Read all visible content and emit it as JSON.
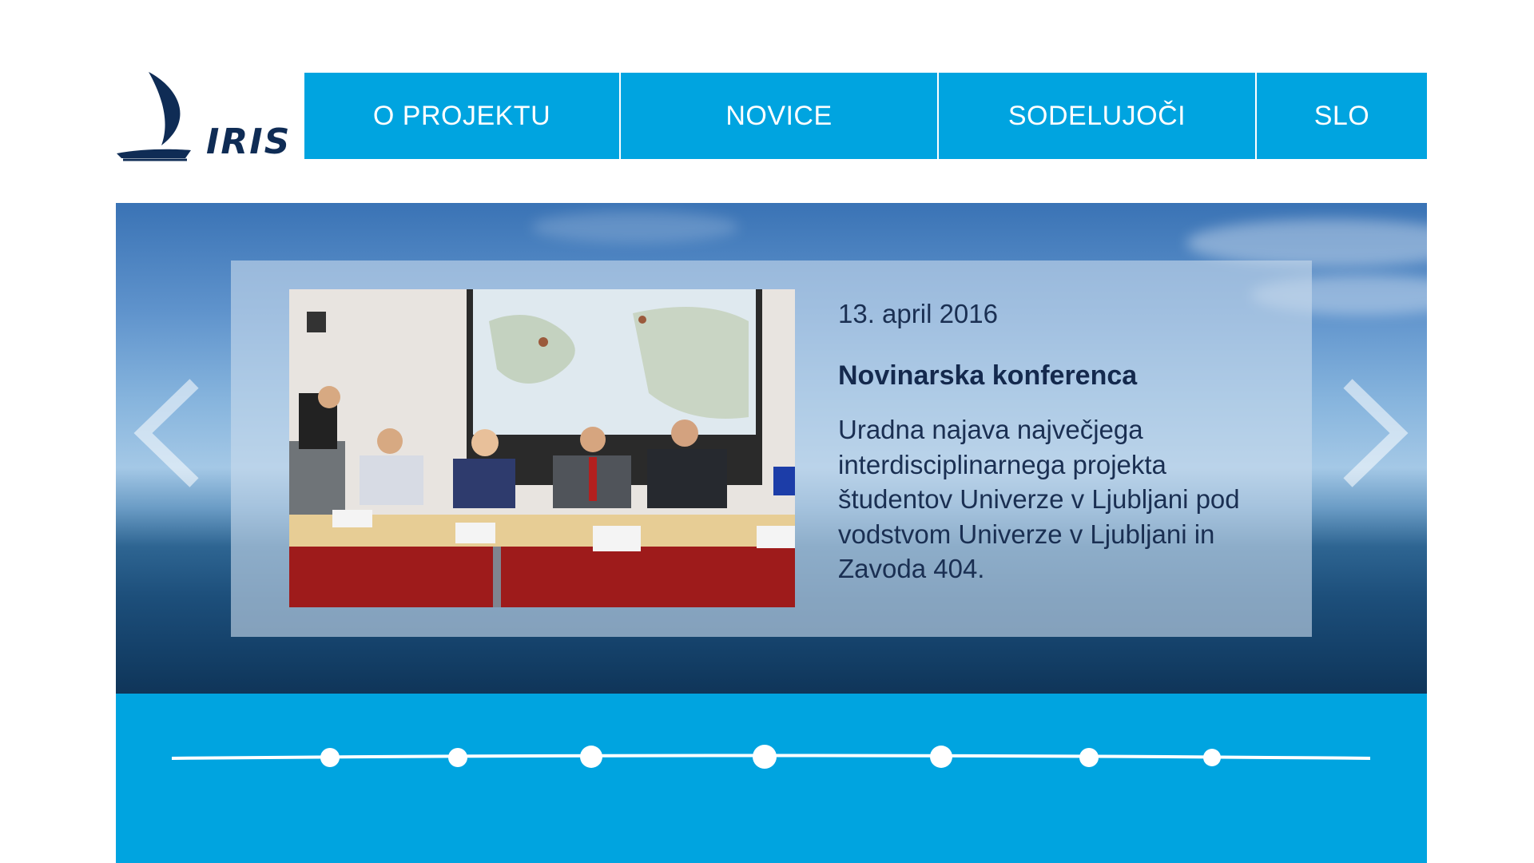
{
  "brand": {
    "name": "IRIS"
  },
  "nav": {
    "items": [
      {
        "label": "O PROJEKTU"
      },
      {
        "label": "NOVICE"
      },
      {
        "label": "SODELUJOČI"
      },
      {
        "label": "SLO"
      }
    ]
  },
  "slide": {
    "date": "13.  april 2016",
    "title": "Novinarska konferenca",
    "text": "Uradna najava največjega interdisciplinarnega projekta študentov Univerze v Ljubljani pod vodstvom Univerze v Ljubljani in Zavoda 404."
  },
  "colors": {
    "accent": "#00a4e0",
    "navy": "#0f2c55",
    "text": "#1a2f52"
  },
  "icons": {
    "prev": "chevron-left-icon",
    "next": "chevron-right-icon",
    "logo": "sail-boat-icon"
  },
  "timeline": {
    "points": 7
  }
}
